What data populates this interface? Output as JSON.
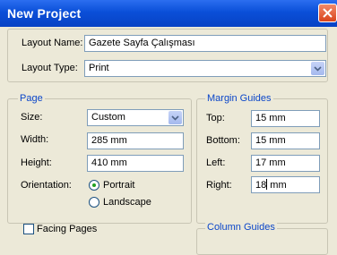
{
  "window": {
    "title": "New Project"
  },
  "layout_name": {
    "label": "Layout Name:",
    "value": "Gazete Sayfa Çalışması"
  },
  "layout_type": {
    "label": "Layout Type:",
    "value": "Print"
  },
  "page": {
    "group_label": "Page",
    "size_label": "Size:",
    "size_value": "Custom",
    "width_label": "Width:",
    "width_value": "285 mm",
    "height_label": "Height:",
    "height_value": "410 mm",
    "orientation_label": "Orientation:",
    "portrait_label": "Portrait",
    "landscape_label": "Landscape",
    "orientation_selected": "Portrait"
  },
  "margin_guides": {
    "group_label": "Margin Guides",
    "top_label": "Top:",
    "top_value": "15 mm",
    "bottom_label": "Bottom:",
    "bottom_value": "15 mm",
    "left_label": "Left:",
    "left_value": "17 mm",
    "right_label": "Right:",
    "right_value_before_caret": "18",
    "right_value_after_caret": " mm"
  },
  "facing_pages": {
    "label": "Facing Pages",
    "checked": false
  },
  "column_guides": {
    "group_label": "Column Guides"
  },
  "icons": {
    "close": "close-icon",
    "dropdown": "chevron-down-icon"
  }
}
